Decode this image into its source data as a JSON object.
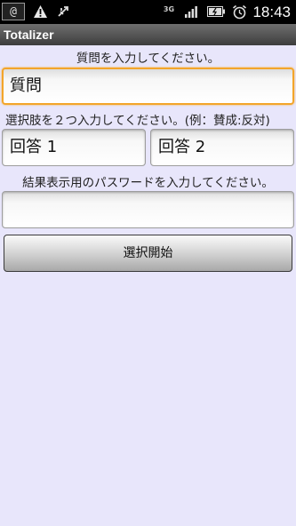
{
  "status_bar": {
    "time": "18:43",
    "network_label": "3G",
    "icons": [
      "at-icon",
      "warning-icon",
      "usb-icon",
      "signal-icon",
      "battery-icon",
      "alarm-icon"
    ]
  },
  "app": {
    "title": "Totalizer"
  },
  "form": {
    "question_prompt": "質問を入力してください。",
    "question_value": "質問",
    "choices_prompt": "選択肢を２つ入力してください。(例：賛成:反対)",
    "answer1_value": "回答 1",
    "answer2_value": "回答 2",
    "password_prompt": "結果表示用のパスワードを入力してください。",
    "password_value": "",
    "start_button_label": "選択開始"
  },
  "colors": {
    "background": "#e8e6fb",
    "focus_border": "#f3a52a",
    "status_bar": "#000000"
  }
}
